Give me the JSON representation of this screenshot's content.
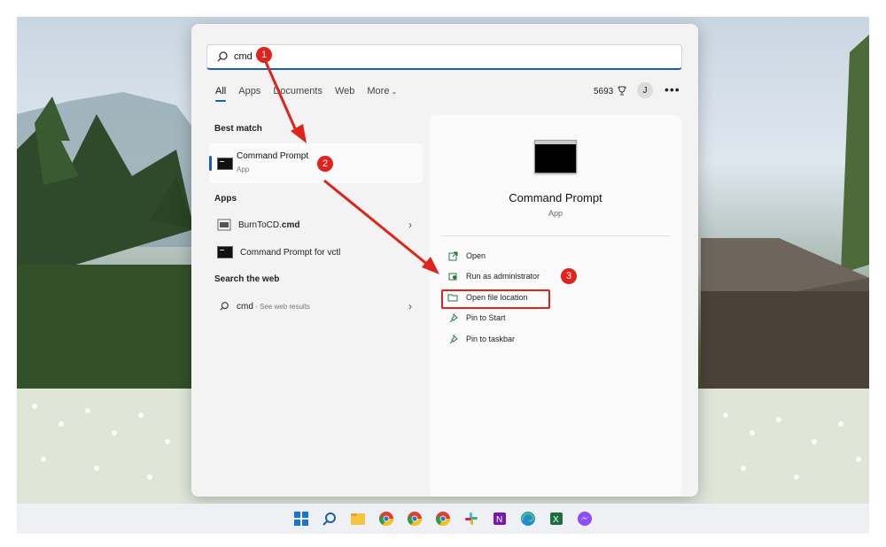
{
  "search": {
    "query": "cmd"
  },
  "tabs": [
    {
      "label": "All"
    },
    {
      "label": "Apps"
    },
    {
      "label": "Documents"
    },
    {
      "label": "Web"
    },
    {
      "label": "More"
    }
  ],
  "rewards": {
    "points": "5693"
  },
  "user": {
    "initial": "J"
  },
  "results": {
    "best_match_heading": "Best match",
    "best_match": {
      "title": "Command Prompt",
      "subtitle": "App"
    },
    "apps_heading": "Apps",
    "apps": [
      {
        "title_prefix": "BurnToCD.",
        "title_bold": "cmd"
      },
      {
        "title": "Command Prompt for vctl"
      }
    ],
    "web_heading": "Search the web",
    "web": {
      "query": "cmd",
      "hint": " - See web results"
    }
  },
  "detail": {
    "title": "Command Prompt",
    "subtitle": "App",
    "actions": [
      {
        "label": "Open",
        "icon": "open-icon"
      },
      {
        "label": "Run as administrator",
        "icon": "shield-icon"
      },
      {
        "label": "Open file location",
        "icon": "folder-icon"
      },
      {
        "label": "Pin to Start",
        "icon": "pin-icon"
      },
      {
        "label": "Pin to taskbar",
        "icon": "pin-icon"
      }
    ]
  },
  "annotations": [
    {
      "number": "1"
    },
    {
      "number": "2"
    },
    {
      "number": "3"
    }
  ],
  "colors": {
    "accent": "#1a5fb4",
    "annotation": "#e0241b"
  }
}
